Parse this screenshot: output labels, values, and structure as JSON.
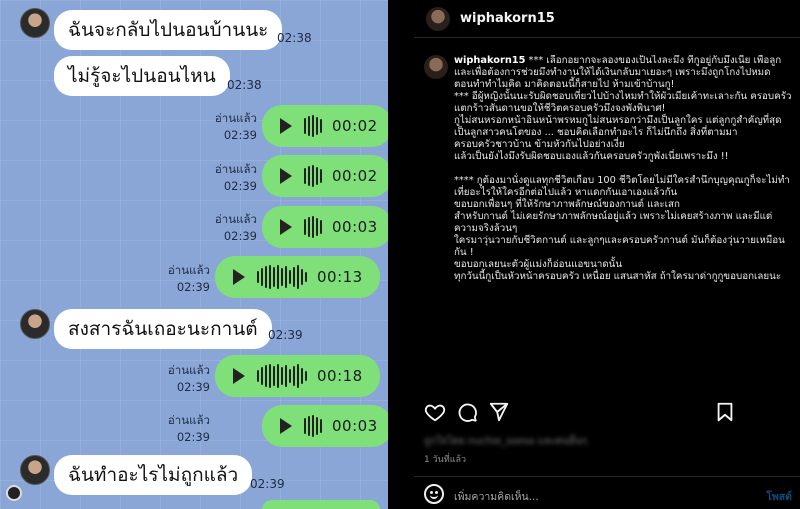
{
  "chat": {
    "messages_in": [
      {
        "text": "ฉันจะกลับไปนอนบ้านนะ",
        "time": "02:38"
      },
      {
        "text": "ไม่รู้จะไปนอนไหน",
        "time": "02:38"
      },
      {
        "text": "สงสารฉันเถอะนะกานต์",
        "time": "02:39"
      },
      {
        "text": "ฉันทำอะไรไม่ถูกแล้ว",
        "time": "02:39"
      }
    ],
    "voice": [
      {
        "read": "อ่านแล้ว",
        "time": "02:39",
        "duration": "00:02"
      },
      {
        "read": "อ่านแล้ว",
        "time": "02:39",
        "duration": "00:02"
      },
      {
        "read": "อ่านแล้ว",
        "time": "02:39",
        "duration": "00:03"
      },
      {
        "read": "อ่านแล้ว",
        "time": "02:39",
        "duration": "00:13"
      },
      {
        "read": "อ่านแล้ว",
        "time": "02:39",
        "duration": "00:18"
      },
      {
        "read": "อ่านแล้ว",
        "time": "02:39",
        "duration": "00:03"
      }
    ]
  },
  "instagram": {
    "username": "wiphakorn15",
    "caption_user": "wiphakorn15",
    "caption_text": " *** เลือกอยากจะลองของเป็นไงละมึง ที่กูอยู่กับมึงเนี่ย เพื่อลูก และเพื่อต้องการช่วยมึงทำงานให้ได้เงินกลับมาเยอะๆ เพราะมึงถูกโกงไปหมด\nตอนทำทำไมคิด มาคิดตอนนี้ก็สายไป ห้ามเข้าบ้านกู!\n*** อีผู้หญิงนั้นนะรับผิดชอบเที่ยวไปบ้างไหมทำให้ผัวเมียเค้าทะเลาะกัน ครอบครัวแตกร้าวสันดานขอให้ชีวิตครอบครัวมึงจงพังพินาศ!\nกูไม่สนหรอกหน้าอินหน้าพรหมกูไม่สนหรอกว่ามึงเป็นลูกใคร แต่ลูกกูสำคัญที่สุด เป็นลูกสาวคนโตของ ... ชอบคิดเลือกทำอะไร ก็ไม่นึกถึง สิ่งที่ตามมา\nครอบครัวชาวบ้าน ข้ามหัวกันไปอย่างเงี่ย\nแล้วเป็นยังไงมึงรับผิดชอบเองแล้วกันครอบครัวกูพังเนี่ยเพราะมึง !!\n\n**** กูต้องมานั่งดูแลทุกชีวิตเกือบ 100 ชีวิตโดยไม่มีใครสำนึกบุญคุณกูก็จะไม่ทำเที่ยอะไรให้ใครอีกต่อไปแล้ว หาแดกกันเอาเองแล้วกัน\nขอบอกเพื่อนๆ ที่ให้รักษาภาพลักษณ์ของกานต์ และเสก\nสำหรับกานต์ ไม่เคยรักษาภาพลักษณ์อยู่แล้ว เพราะไม่เคยสร้างภาพ และมีแต่ความจริงล้วนๆ\nใครมาวุ่นวายกับชีวิตกานต์ และลูกๆและครอบครัวกานต์ มันก็ต้องวุ่นวายเหมือนกัน !\nขอบอกเลยนะตัวผู้แม่งก็อ่อนแอขนาดนั้น\nทุกวันนี้กูเป็นหัวหน้าครอบครัว เหนื่อย แสนสาหัส ถ้าใครมาด่ากูกูขอบอกเลยนะ",
    "likes_blurred": "ถูกใจโดย nuchie_ssesa และคนอื่นๆ",
    "post_time": "1 วันที่แล้ว",
    "comment_placeholder": "เพิ่มความคิดเห็น...",
    "post_label": "โพสต์"
  }
}
